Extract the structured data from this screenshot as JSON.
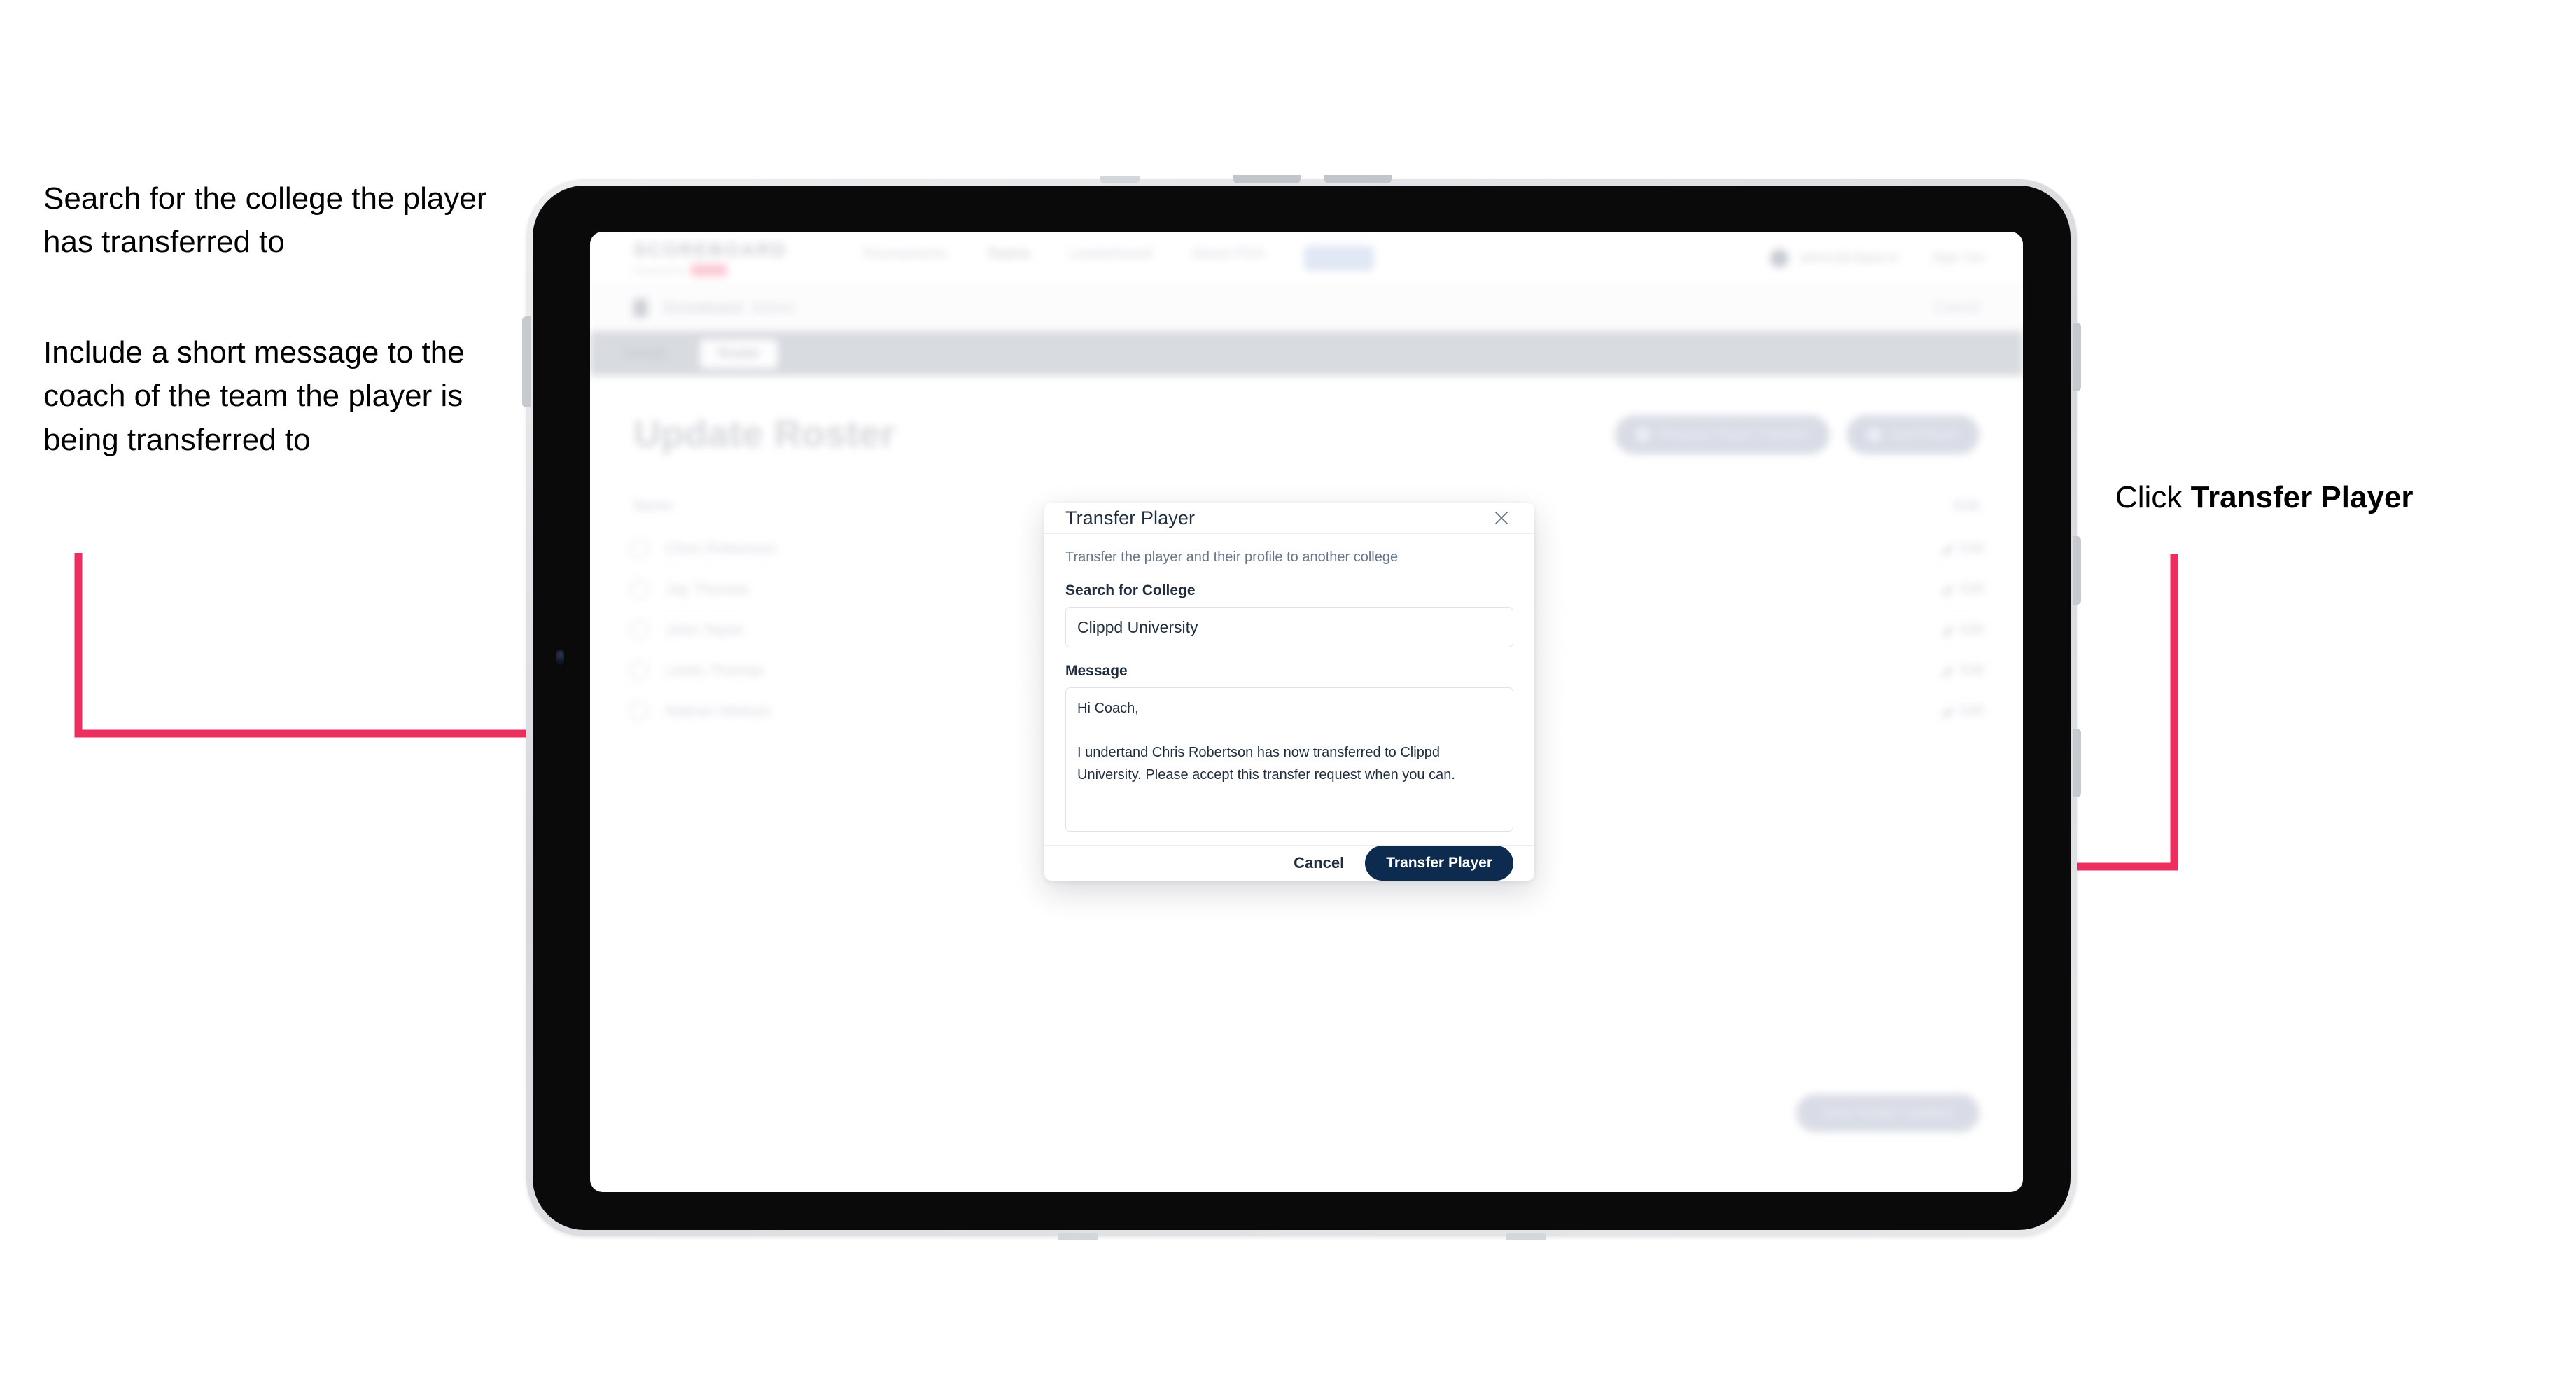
{
  "annotations": {
    "left_top": "Search for the college the player has transferred to",
    "left_bottom": "Include a short message to the coach of the team the player is being transferred to",
    "right_prefix": "Click ",
    "right_bold": "Transfer Player"
  },
  "colors": {
    "arrow": "#ED2F60",
    "primary_button": "#0C2B4E",
    "modal_title": "#1F2D3D",
    "muted_text": "#65748A"
  },
  "app": {
    "logo": {
      "main": "SCOREBOARD",
      "sub": "Powered by",
      "badge": "Clippd"
    },
    "nav_items": [
      {
        "label": "Tournaments"
      },
      {
        "label": "Teams"
      },
      {
        "label": "Leaderboard"
      },
      {
        "label": "About PGA"
      },
      {
        "label": "Admin"
      }
    ],
    "nav_right": {
      "user": "admin@clippd.io",
      "sign_out": "Sign Out"
    },
    "breadcrumb": {
      "title": "Scoreboard",
      "suffix": "Admin",
      "right_action": "Cancel"
    },
    "tabs": [
      {
        "label": "Details",
        "active": false
      },
      {
        "label": "Roster",
        "active": true
      }
    ],
    "page_title": "Update Roster",
    "top_actions": [
      {
        "label": "Request Player Transfer",
        "icon": "transfer-icon"
      },
      {
        "label": "Add Player",
        "icon": "plus-icon"
      }
    ],
    "list_header_left": "Name",
    "list_header_right": "Edit",
    "rows": [
      {
        "name": "Chris Robertson",
        "action": "Edit"
      },
      {
        "name": "Jay Thomas",
        "action": "Edit"
      },
      {
        "name": "John Taylor",
        "action": "Edit"
      },
      {
        "name": "Lewis Thomas",
        "action": "Edit"
      },
      {
        "name": "Nathan Watson",
        "action": "Edit"
      }
    ],
    "save_button": "Save Roster Updates"
  },
  "modal": {
    "title": "Transfer Player",
    "close_icon": "close-icon",
    "subtitle": "Transfer the player and their profile to another college",
    "college_label": "Search for College",
    "college_value": "Clippd University",
    "college_placeholder": "Search for College",
    "message_label": "Message",
    "message_value": "Hi Coach,\n\nI undertand Chris Robertson has now transferred to Clippd University. Please accept this transfer request when you can.",
    "message_placeholder": "Message",
    "cancel_label": "Cancel",
    "submit_label": "Transfer Player"
  }
}
